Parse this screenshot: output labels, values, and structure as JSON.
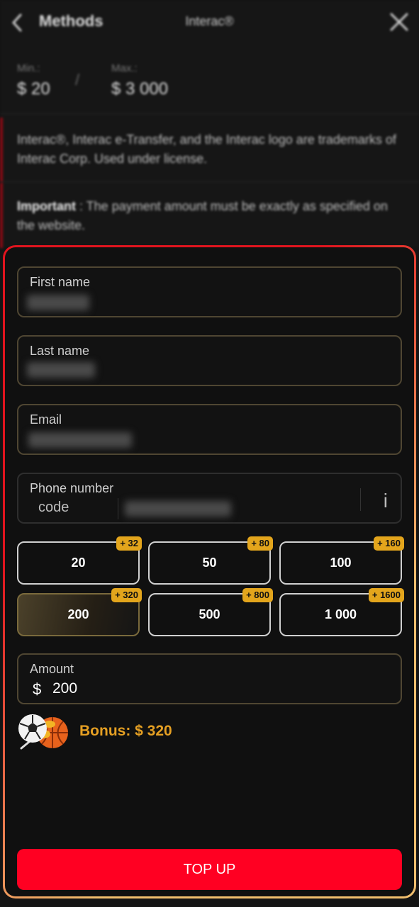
{
  "header": {
    "back_label": "Methods",
    "subtitle": "Interac®"
  },
  "limits": {
    "min_label": "Min.:",
    "min_value": "$ 20",
    "max_label": "Max.:",
    "max_value": "$ 3 000"
  },
  "notes": {
    "trademark": "Interac®, Interac e-Transfer, and the Interac logo are trademarks of Interac Corp. Used under license.",
    "important_label": "Important",
    "important_text": " : The payment amount must be exactly as specified on the website."
  },
  "form": {
    "first_name_label": "First name",
    "last_name_label": "Last name",
    "email_label": "Email",
    "phone_label": "Phone number",
    "phone_code_label": "code",
    "info_icon": "i"
  },
  "amount_chips": [
    {
      "value": "20",
      "bonus": "+ 32",
      "selected": false
    },
    {
      "value": "50",
      "bonus": "+ 80",
      "selected": false
    },
    {
      "value": "100",
      "bonus": "+ 160",
      "selected": false
    },
    {
      "value": "200",
      "bonus": "+ 320",
      "selected": true
    },
    {
      "value": "500",
      "bonus": "+ 800",
      "selected": false
    },
    {
      "value": "1 000",
      "bonus": "+ 1600",
      "selected": false
    }
  ],
  "amount": {
    "label": "Amount",
    "currency": "$",
    "value": "200"
  },
  "bonus": {
    "text": "Bonus: $ 320",
    "icon": "sports-balls-icon"
  },
  "submit": {
    "label": "TOP UP"
  },
  "colors": {
    "accent_red": "#ff0022",
    "bonus_gold": "#e6a023",
    "badge_gold": "#e3a51c"
  }
}
